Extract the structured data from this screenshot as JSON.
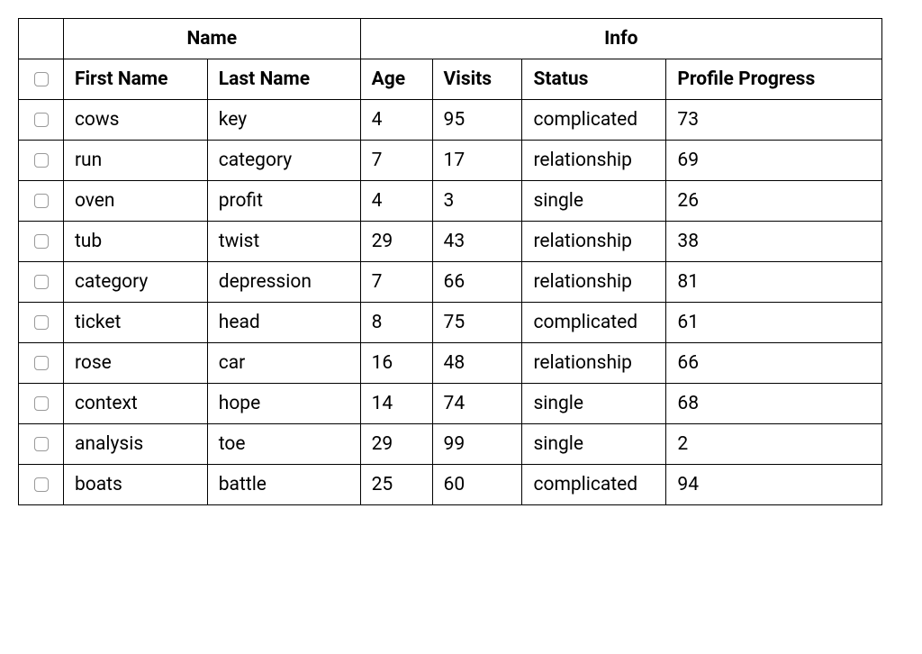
{
  "headers": {
    "group_name": "Name",
    "group_info": "Info",
    "first_name": "First Name",
    "last_name": "Last Name",
    "age": "Age",
    "visits": "Visits",
    "status": "Status",
    "profile_progress": "Profile Progress"
  },
  "rows": [
    {
      "first_name": "cows",
      "last_name": "key",
      "age": "4",
      "visits": "95",
      "status": "complicated",
      "profile_progress": "73"
    },
    {
      "first_name": "run",
      "last_name": "category",
      "age": "7",
      "visits": "17",
      "status": "relationship",
      "profile_progress": "69"
    },
    {
      "first_name": "oven",
      "last_name": "profit",
      "age": "4",
      "visits": "3",
      "status": "single",
      "profile_progress": "26"
    },
    {
      "first_name": "tub",
      "last_name": "twist",
      "age": "29",
      "visits": "43",
      "status": "relationship",
      "profile_progress": "38"
    },
    {
      "first_name": "category",
      "last_name": "depression",
      "age": "7",
      "visits": "66",
      "status": "relationship",
      "profile_progress": "81"
    },
    {
      "first_name": "ticket",
      "last_name": "head",
      "age": "8",
      "visits": "75",
      "status": "complicated",
      "profile_progress": "61"
    },
    {
      "first_name": "rose",
      "last_name": "car",
      "age": "16",
      "visits": "48",
      "status": "relationship",
      "profile_progress": "66"
    },
    {
      "first_name": "context",
      "last_name": "hope",
      "age": "14",
      "visits": "74",
      "status": "single",
      "profile_progress": "68"
    },
    {
      "first_name": "analysis",
      "last_name": "toe",
      "age": "29",
      "visits": "99",
      "status": "single",
      "profile_progress": "2"
    },
    {
      "first_name": "boats",
      "last_name": "battle",
      "age": "25",
      "visits": "60",
      "status": "complicated",
      "profile_progress": "94"
    }
  ]
}
